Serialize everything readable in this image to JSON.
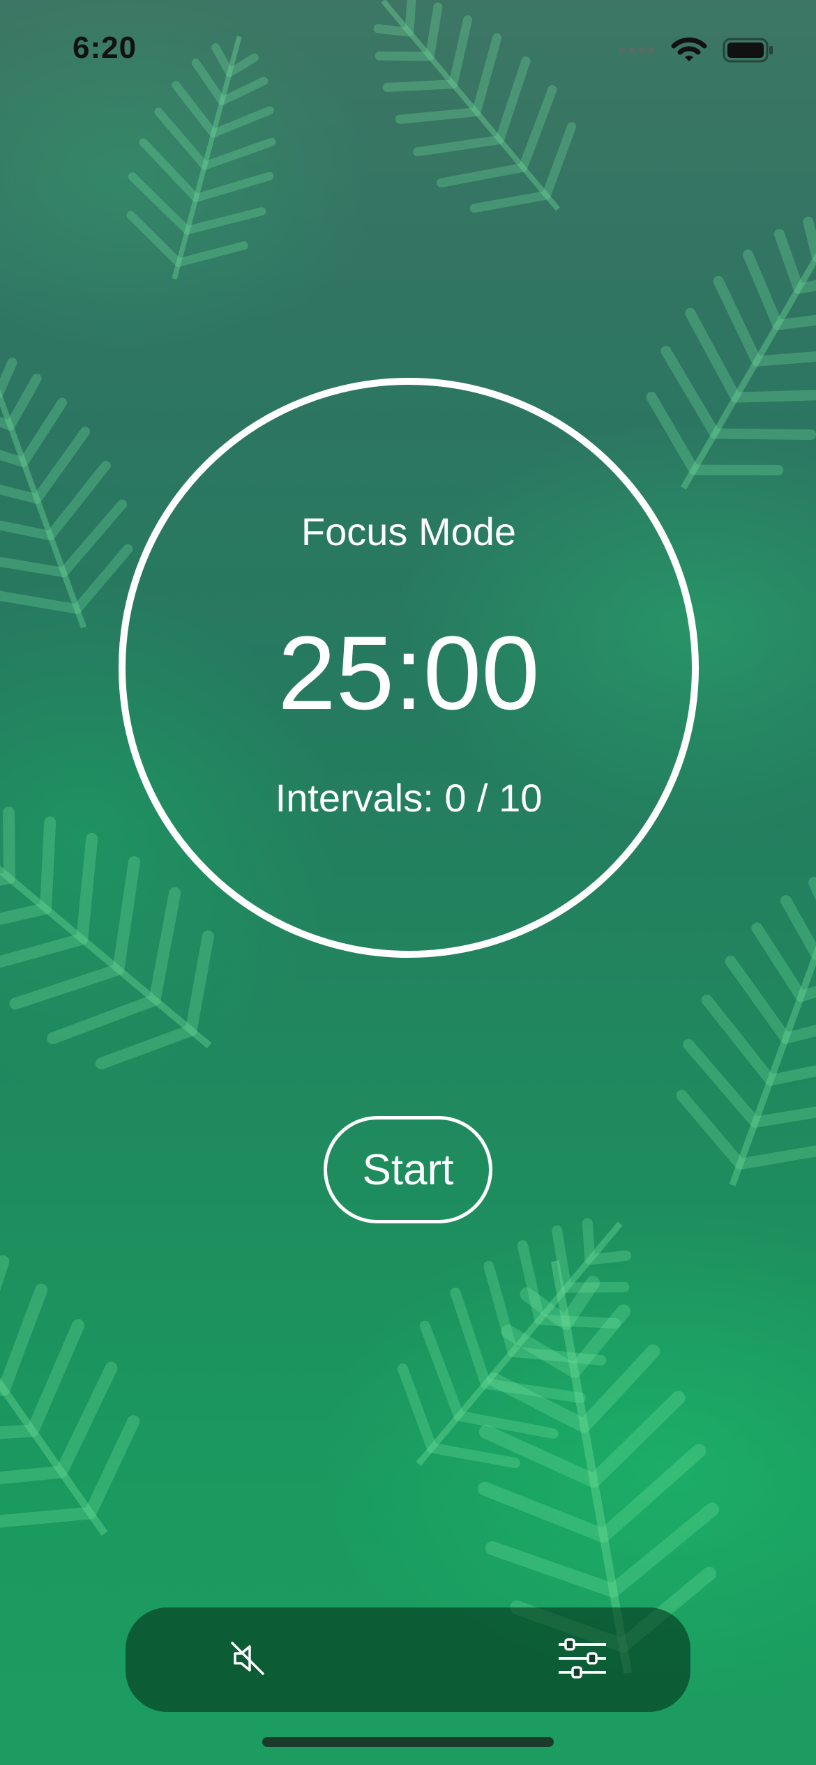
{
  "status_bar": {
    "time": "6:20",
    "icons": [
      "signal-icon",
      "wifi-icon",
      "battery-icon"
    ]
  },
  "timer": {
    "mode_label": "Focus Mode",
    "time": "25:00",
    "intervals_label": "Intervals: 0 /  10"
  },
  "controls": {
    "start_label": "Start"
  },
  "bottom_bar": {
    "icons": [
      "sound-off-icon",
      "settings-sliders-icon"
    ]
  },
  "colors": {
    "foreground": "#ffffff",
    "background_green": "#1f8b5e"
  }
}
